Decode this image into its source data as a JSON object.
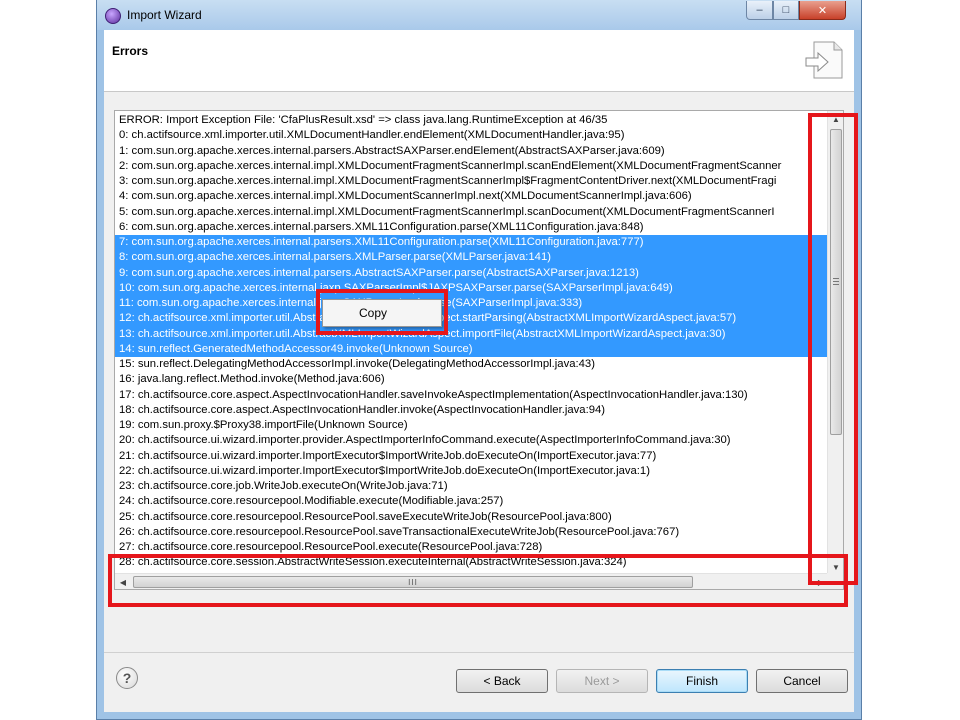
{
  "window": {
    "title": "Import Wizard",
    "controls": {
      "minimize": "–",
      "maximize": "□",
      "close": "✕"
    }
  },
  "header": {
    "title": "Errors",
    "icon": "import-wizard-icon"
  },
  "log": {
    "selected_range": [
      8,
      15
    ],
    "lines": [
      "ERROR: Import Exception File: 'CfaPlusResult.xsd' => class java.lang.RuntimeException at 46/35",
      "0: ch.actifsource.xml.importer.util.XMLDocumentHandler.endElement(XMLDocumentHandler.java:95)",
      "1: com.sun.org.apache.xerces.internal.parsers.AbstractSAXParser.endElement(AbstractSAXParser.java:609)",
      "2: com.sun.org.apache.xerces.internal.impl.XMLDocumentFragmentScannerImpl.scanEndElement(XMLDocumentFragmentScanner",
      "3: com.sun.org.apache.xerces.internal.impl.XMLDocumentFragmentScannerImpl$FragmentContentDriver.next(XMLDocumentFragi",
      "4: com.sun.org.apache.xerces.internal.impl.XMLDocumentScannerImpl.next(XMLDocumentScannerImpl.java:606)",
      "5: com.sun.org.apache.xerces.internal.impl.XMLDocumentFragmentScannerImpl.scanDocument(XMLDocumentFragmentScannerI",
      "6: com.sun.org.apache.xerces.internal.parsers.XML11Configuration.parse(XML11Configuration.java:848)",
      "7: com.sun.org.apache.xerces.internal.parsers.XML11Configuration.parse(XML11Configuration.java:777)",
      "8: com.sun.org.apache.xerces.internal.parsers.XMLParser.parse(XMLParser.java:141)",
      "9: com.sun.org.apache.xerces.internal.parsers.AbstractSAXParser.parse(AbstractSAXParser.java:1213)",
      "10: com.sun.org.apache.xerces.internal.jaxp.SAXParserImpl$JAXPSAXParser.parse(SAXParserImpl.java:649)",
      "11: com.sun.org.apache.xerces.internal.jaxp.SAXParserImpl.parse(SAXParserImpl.java:333)",
      "12: ch.actifsource.xml.importer.util.AbstractXMLImportWizardAspect.startParsing(AbstractXMLImportWizardAspect.java:57)",
      "13: ch.actifsource.xml.importer.util.AbstractXMLImportWizardAspect.importFile(AbstractXMLImportWizardAspect.java:30)",
      "14: sun.reflect.GeneratedMethodAccessor49.invoke(Unknown Source)",
      "15: sun.reflect.DelegatingMethodAccessorImpl.invoke(DelegatingMethodAccessorImpl.java:43)",
      "16: java.lang.reflect.Method.invoke(Method.java:606)",
      "17: ch.actifsource.core.aspect.AspectInvocationHandler.saveInvokeAspectImplementation(AspectInvocationHandler.java:130)",
      "18: ch.actifsource.core.aspect.AspectInvocationHandler.invoke(AspectInvocationHandler.java:94)",
      "19: com.sun.proxy.$Proxy38.importFile(Unknown Source)",
      "20: ch.actifsource.ui.wizard.importer.provider.AspectImporterInfoCommand.execute(AspectImporterInfoCommand.java:30)",
      "21: ch.actifsource.ui.wizard.importer.ImportExecutor$ImportWriteJob.doExecuteOn(ImportExecutor.java:77)",
      "22: ch.actifsource.ui.wizard.importer.ImportExecutor$ImportWriteJob.doExecuteOn(ImportExecutor.java:1)",
      "23: ch.actifsource.core.job.WriteJob.executeOn(WriteJob.java:71)",
      "24: ch.actifsource.core.resourcepool.Modifiable.execute(Modifiable.java:257)",
      "25: ch.actifsource.core.resourcepool.ResourcePool.saveExecuteWriteJob(ResourcePool.java:800)",
      "26: ch.actifsource.core.resourcepool.ResourcePool.saveTransactionalExecuteWriteJob(ResourcePool.java:767)",
      "27: ch.actifsource.core.resourcepool.ResourcePool.execute(ResourcePool.java:728)",
      "28: ch.actifsource.core.session.AbstractWriteSession.executeInternal(AbstractWriteSession.java:324)"
    ]
  },
  "scrollbar": {
    "h_thumb_grip": "III"
  },
  "context_menu": {
    "copy_label": "Copy"
  },
  "footer": {
    "help": "?",
    "back_label": "< Back",
    "next_label": "Next >",
    "finish_label": "Finish",
    "cancel_label": "Cancel"
  },
  "colors": {
    "selection": "#3399ff",
    "annotation_border": "#e5161b"
  }
}
